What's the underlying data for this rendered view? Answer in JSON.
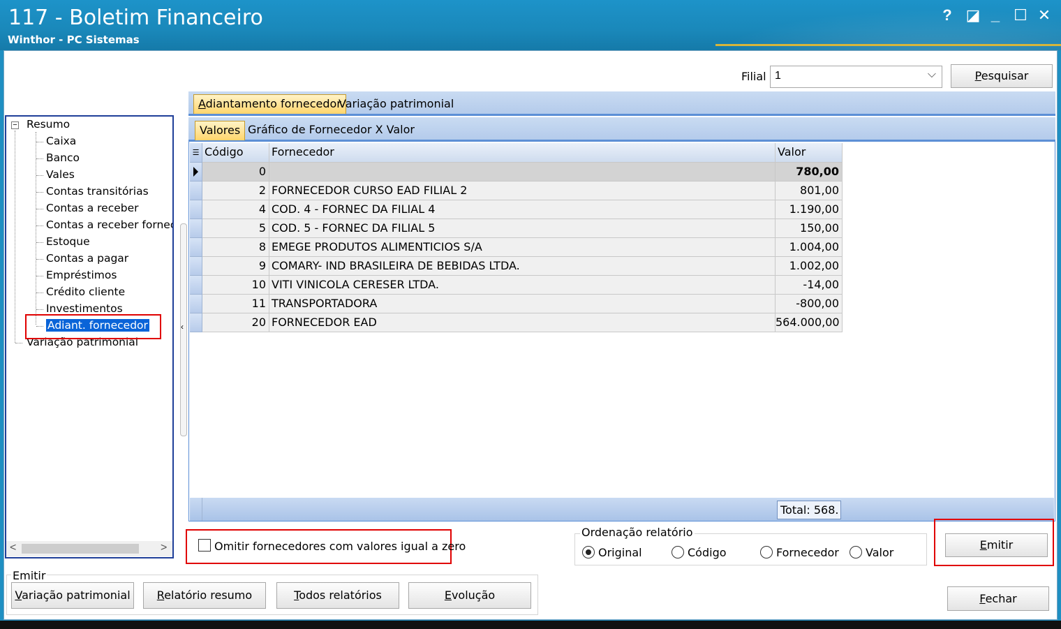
{
  "window": {
    "title": "117 - Boletim Financeiro",
    "subtitle": "Winthor - PC Sistemas",
    "controls": {
      "help": "?",
      "restore": "◪",
      "minimize": "_",
      "maximize": "☐",
      "close": "✕"
    }
  },
  "filter": {
    "filial_label": "Filial",
    "filial_value": "1",
    "search_button_prefix": "",
    "search_button_underline": "P",
    "search_button_rest": "esquisar"
  },
  "tree": {
    "root": "Resumo",
    "items": [
      "Caixa",
      "Banco",
      "Vales",
      "Contas transitórias",
      "Contas a receber",
      "Contas a receber fornec.",
      "Estoque",
      "Contas a pagar",
      "Empréstimos",
      "Crédito cliente",
      "Investimentos",
      "Adiant. fornecedor"
    ],
    "root2": "Variação patrimonial",
    "selected_index": 11
  },
  "tabs": {
    "main": [
      {
        "underline": "A",
        "rest": "diantamento fornecedor"
      },
      {
        "label": "Variação patrimonial"
      }
    ],
    "sub": [
      {
        "label": "Valores"
      },
      {
        "label": "Gráfico de Fornecedor X Valor"
      }
    ]
  },
  "grid": {
    "headers": {
      "codigo": "Código",
      "fornecedor": "Fornecedor",
      "valor": "Valor"
    },
    "rows": [
      {
        "codigo": "0",
        "fornecedor": "",
        "valor": "780,00"
      },
      {
        "codigo": "2",
        "fornecedor": "FORNECEDOR CURSO EAD FILIAL 2",
        "valor": "801,00"
      },
      {
        "codigo": "4",
        "fornecedor": "COD. 4 - FORNEC DA FILIAL 4",
        "valor": "1.190,00"
      },
      {
        "codigo": "5",
        "fornecedor": "COD. 5 - FORNEC DA FILIAL 5",
        "valor": "150,00"
      },
      {
        "codigo": "8",
        "fornecedor": "EMEGE PRODUTOS ALIMENTICIOS S/A",
        "valor": "1.004,00"
      },
      {
        "codigo": "9",
        "fornecedor": "COMARY- IND BRASILEIRA DE BEBIDAS LTDA.",
        "valor": "1.002,00"
      },
      {
        "codigo": "10",
        "fornecedor": "VITI VINICOLA CERESER LTDA.",
        "valor": "-14,00"
      },
      {
        "codigo": "11",
        "fornecedor": "TRANSPORTADORA",
        "valor": "-800,00"
      },
      {
        "codigo": "20",
        "fornecedor": "FORNECEDOR EAD",
        "valor": "564.000,00"
      }
    ],
    "total": "Total: 568."
  },
  "options": {
    "omit_zero_label": "Omitir fornecedores com valores igual a zero",
    "omit_zero_checked": false,
    "ordering_title": "Ordenação relatório",
    "ordering": [
      {
        "label": "Original",
        "selected": true
      },
      {
        "label": "Código",
        "selected": false
      },
      {
        "label": "Fornecedor",
        "selected": false
      },
      {
        "label": "Valor",
        "selected": false
      }
    ],
    "emit_button": {
      "underline": "E",
      "rest": "mitir"
    }
  },
  "emit_group": {
    "title": "Emitir",
    "buttons": [
      {
        "underline": "V",
        "rest": "ariação patrimonial"
      },
      {
        "underline": "R",
        "rest": "elatório resumo"
      },
      {
        "underline": "T",
        "rest": "odos relatórios"
      },
      {
        "underline": "E",
        "rest": "volução"
      }
    ]
  },
  "close_button": {
    "underline": "F",
    "rest": "echar"
  }
}
